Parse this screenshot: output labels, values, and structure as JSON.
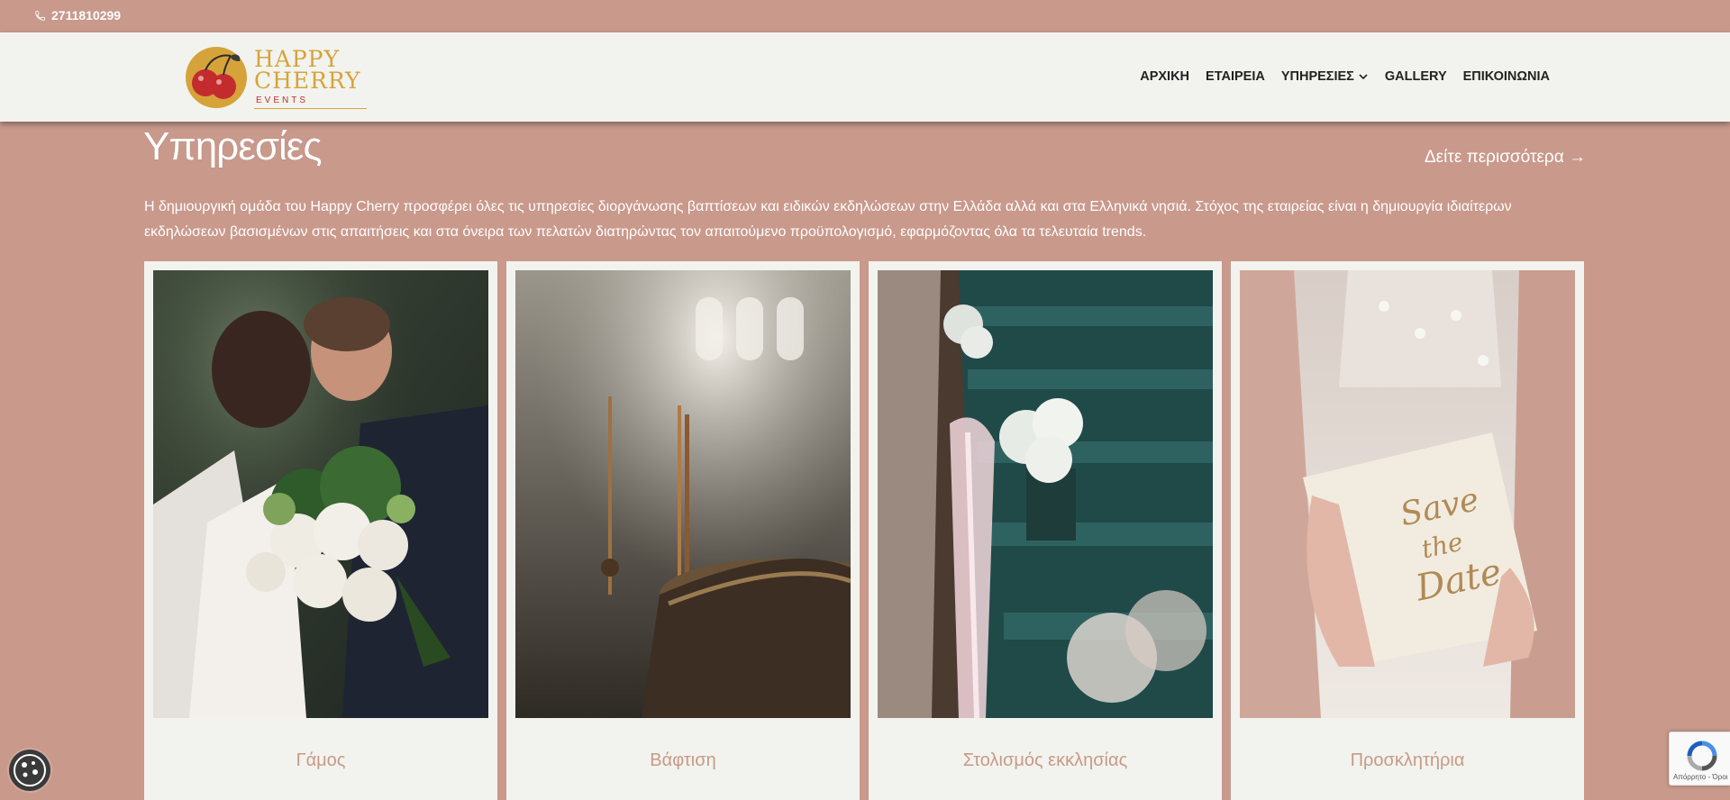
{
  "topbar": {
    "phone": "2711810299",
    "phone_icon": "phone-icon"
  },
  "logo": {
    "line1": "HAPPY",
    "line2": "CHERRY",
    "line3": "EVENTS"
  },
  "nav": {
    "items": [
      {
        "label": "ΑΡΧΙΚΗ"
      },
      {
        "label": "ΕΤΑΙΡΕΙΑ"
      },
      {
        "label": "ΥΠΗΡΕΣΙΕΣ",
        "icon": "chevron-down-icon"
      },
      {
        "label": "GALLERY"
      },
      {
        "label": "ΕΠΙΚΟΙΝΩΝΙΑ"
      }
    ]
  },
  "section": {
    "title": "Υπηρεσίες",
    "see_more": "Δείτε περισσότερα →",
    "intro": "Η δημιουργική ομάδα του Happy Cherry προσφέρει όλες τις υπηρεσίες διοργάνωσης βαπτίσεων και ειδικών εκδηλώσεων στην Ελλάδα αλλά και στα Ελληνικά νησιά. Στόχος της εταιρείας είναι η δημιουργία ιδιαίτερων εκδηλώσεων βασισμένων στις απαιτήσεις και στα όνειρα των πελατών διατηρώντας τον απαιτούμενο προϋπολογισμό, εφαρμόζοντας όλα τα τελευταία trends."
  },
  "cards": [
    {
      "caption": "Γάμος"
    },
    {
      "caption": "Βάφτιση"
    },
    {
      "caption": "Στολισμός εκκλησίας"
    },
    {
      "caption": "Προσκλητήρια"
    }
  ],
  "recaptcha": {
    "label": "Απόρρητο - Όροι"
  },
  "colors": {
    "background": "#c9998b",
    "header": "#f2f3ee",
    "caption": "#c79a86",
    "logo_gold": "#d6a33a",
    "logo_red": "#c42b2f"
  }
}
